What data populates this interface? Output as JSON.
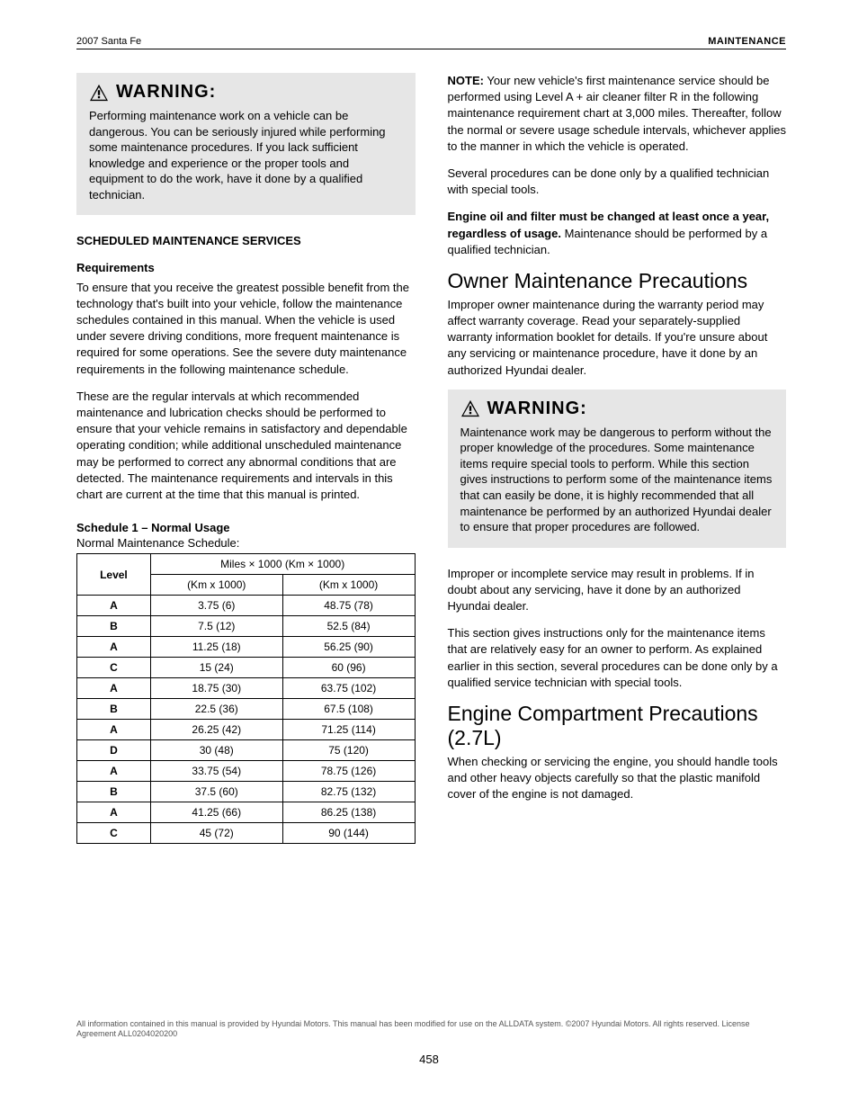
{
  "header": {
    "date": "2007 Santa Fe",
    "section": "MAINTENANCE"
  },
  "left": {
    "warning": {
      "label": "WARNING:",
      "body": "Performing maintenance work on a vehicle can be dangerous. You can be seriously injured while performing some maintenance procedures. If you lack sufficient knowledge and experience or the proper tools and equipment to do the work, have it done by a qualified technician."
    },
    "scheduled_heading": "SCHEDULED MAINTENANCE SERVICES",
    "p1_label": "Requirements",
    "p1": "To ensure that you receive the greatest possible benefit from the technology that's built into your vehicle, follow the maintenance schedules contained in this manual. When the vehicle is used under severe driving conditions, more frequent maintenance is required for some operations. See the severe duty maintenance requirements in the following maintenance schedule.",
    "p2": "These are the regular intervals at which recommended maintenance and lubrication checks should be performed to ensure that your vehicle remains in satisfactory and dependable operating condition; while additional unscheduled maintenance may be performed to correct any abnormal conditions that are detected. The maintenance requirements and intervals in this chart are current at the time that this manual is printed.",
    "sched_title": "Schedule 1 – Normal Usage",
    "sched_sub": "Normal Maintenance Schedule:",
    "table": {
      "top": "Miles × 1000 (Km × 1000)",
      "c1": "(Km x 1000)",
      "c2": "(Km x 1000)",
      "lvl": "Level",
      "rows": [
        {
          "l": "A",
          "a": "3.75 (6)",
          "b": "48.75 (78)"
        },
        {
          "l": "B",
          "a": "7.5 (12)",
          "b": "52.5 (84)"
        },
        {
          "l": "A",
          "a": "11.25 (18)",
          "b": "56.25 (90)"
        },
        {
          "l": "C",
          "a": "15 (24)",
          "b": "60 (96)"
        },
        {
          "l": "A",
          "a": "18.75 (30)",
          "b": "63.75 (102)"
        },
        {
          "l": "B",
          "a": "22.5 (36)",
          "b": "67.5 (108)"
        },
        {
          "l": "A",
          "a": "26.25 (42)",
          "b": "71.25 (114)"
        },
        {
          "l": "D",
          "a": "30 (48)",
          "b": "75 (120)"
        },
        {
          "l": "A",
          "a": "33.75 (54)",
          "b": "78.75 (126)"
        },
        {
          "l": "B",
          "a": "37.5 (60)",
          "b": "82.75 (132)"
        },
        {
          "l": "A",
          "a": "41.25 (66)",
          "b": "86.25 (138)"
        },
        {
          "l": "C",
          "a": "45 (72)",
          "b": "90 (144)"
        }
      ]
    }
  },
  "right": {
    "note_label": "NOTE:",
    "note_body": "Your new vehicle's first maintenance service should be performed using Level A + air cleaner filter R in the following maintenance requirement chart at 3,000 miles. Thereafter, follow the normal or severe usage schedule intervals, whichever applies to the manner in which the vehicle is operated.",
    "p2": "Several procedures can be done only by a qualified technician with special tools.",
    "p3_a": "Engine oil and filter must be changed at least once a year, regardless of usage.",
    "p3_b": "Maintenance should be performed by a qualified technician.",
    "h2": "Owner Maintenance Precautions",
    "p4": "Improper owner maintenance during the warranty period may affect warranty coverage. Read your separately-supplied warranty information booklet for details. If you're unsure about any servicing or maintenance procedure, have it done by an authorized Hyundai dealer.",
    "warn2": {
      "label": "WARNING:",
      "body": "Maintenance work may be dangerous to perform without the proper knowledge of the procedures. Some maintenance items require special tools to perform. While this section gives instructions to perform some of the maintenance items that can easily be done, it is highly recommended that all maintenance be performed by an authorized Hyundai dealer to ensure that proper procedures are followed."
    },
    "warn2_after": "Improper or incomplete service may result in problems. If in doubt about any servicing, have it done by an authorized Hyundai dealer.",
    "footnote": "This section gives instructions only for the maintenance items that are relatively easy for an owner to perform. As explained earlier in this section, several procedures can be done only by a qualified service technician with special tools.",
    "h2b": "Engine Compartment Precautions (2.7L)",
    "p5": "When checking or servicing the engine, you should handle tools and other heavy objects carefully so that the plastic manifold cover of the engine is not damaged."
  },
  "footer": {
    "license": "All information contained in this manual is provided by Hyundai Motors. This manual has been modified for use on the ALLDATA system. ©2007 Hyundai Motors. All rights reserved. License Agreement ALL0204020200",
    "page": "458"
  }
}
